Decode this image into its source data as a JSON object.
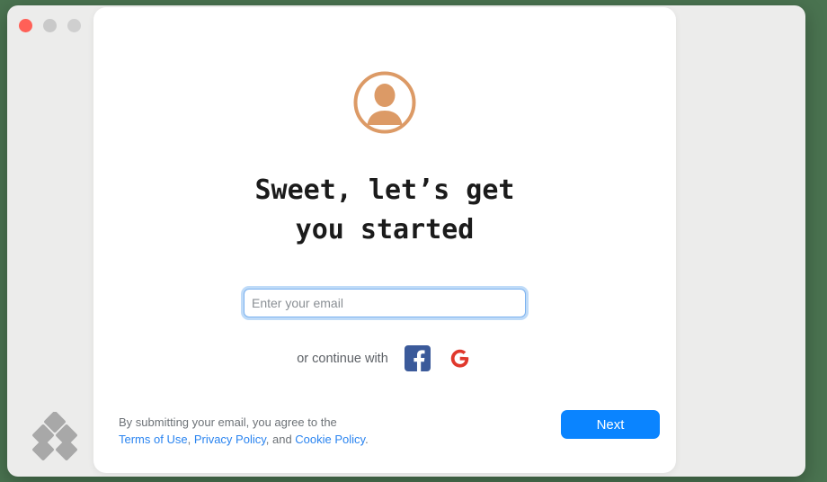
{
  "window": {
    "traffic_lights": [
      {
        "name": "close",
        "color": "#ff6057"
      },
      {
        "name": "minimize",
        "color": "#c9c9c9"
      },
      {
        "name": "zoom",
        "color": "#cfcfcf"
      }
    ]
  },
  "theme": {
    "desktop_background": "#4a7350",
    "window_background": "#ececeb",
    "panel_background": "#ffffff",
    "accent_blue": "#0a84ff",
    "link_blue": "#2a84f0",
    "avatar_orange": "#dc9a66",
    "facebook_blue": "#3b5a9a",
    "google_red": "#e0382c",
    "logo_grey": "#a8a8a8"
  },
  "main": {
    "avatar_icon": "user-avatar-icon",
    "heading": "Sweet, let’s get\nyou started",
    "email": {
      "placeholder": "Enter your email",
      "value": ""
    },
    "social": {
      "label": "or continue with",
      "providers": [
        {
          "name": "facebook",
          "glyph": "f"
        },
        {
          "name": "google",
          "glyph": "G"
        }
      ]
    }
  },
  "footer": {
    "legal_prefix": "By submitting your email, you agree to the",
    "links": [
      {
        "label": "Terms of Use"
      },
      {
        "label": "Privacy Policy"
      },
      {
        "label": "Cookie Policy"
      }
    ],
    "legal_sep_1": ", ",
    "legal_sep_2": ", and ",
    "legal_end": ".",
    "next_label": "Next"
  }
}
